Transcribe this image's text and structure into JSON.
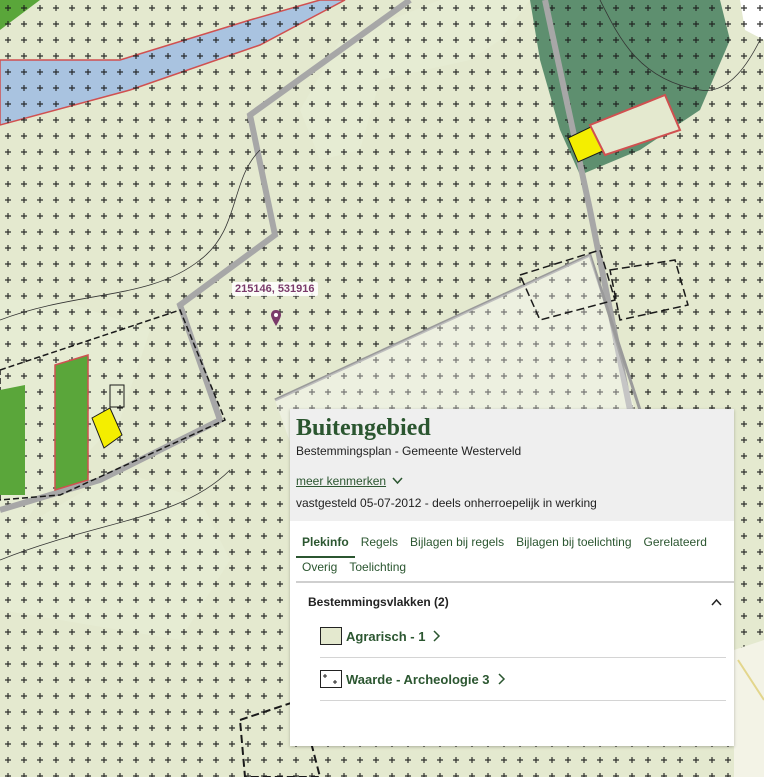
{
  "map": {
    "coordinate_label": "215146, 531916",
    "colors": {
      "agricultural": "#e4e9cf",
      "forest": "#5e8f6f",
      "green_strip": "#5aa63a",
      "yellow_house": "#f4ee00",
      "water": "#a9c3e0",
      "road": "#b0b0b0",
      "pin": "#7a3a6a"
    }
  },
  "panel": {
    "title": "Buitengebied",
    "subtitle": "Bestemmingsplan - Gemeente Westerveld",
    "more_link": "meer kenmerken",
    "status": "vastgesteld 05-07-2012 - deels onherroepelijk in werking",
    "tabs": [
      {
        "label": "Plekinfo",
        "active": true
      },
      {
        "label": "Regels",
        "active": false
      },
      {
        "label": "Bijlagen bij regels",
        "active": false
      },
      {
        "label": "Bijlagen bij toelichting",
        "active": false
      },
      {
        "label": "Gerelateerd",
        "active": false
      },
      {
        "label": "Overig",
        "active": false
      },
      {
        "label": "Toelichting",
        "active": false
      }
    ],
    "section": {
      "title": "Bestemmingsvlakken (2)",
      "items": [
        {
          "label": "Agrarisch - 1",
          "swatch_color": "#e4e9cf"
        },
        {
          "label": "Waarde - Archeologie 3",
          "swatch_color": "#ffffff"
        }
      ]
    }
  }
}
